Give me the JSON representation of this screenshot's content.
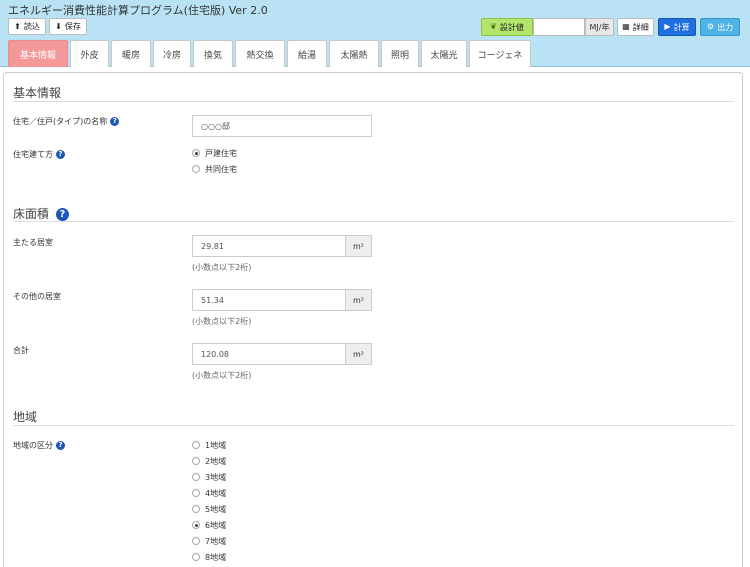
{
  "app": {
    "title": "エネルギー消費性能計算プログラム(住宅版) Ver 2.0"
  },
  "toolbar": {
    "load_label": "読込",
    "save_label": "保存",
    "design_label": "設計値",
    "design_value": "",
    "unit_label": "MJ/年",
    "detail_label": "詳細",
    "calc_label": "計算",
    "output_label": "出力"
  },
  "tabs": [
    {
      "label": "基本情報",
      "active": true
    },
    {
      "label": "外皮"
    },
    {
      "label": "暖房"
    },
    {
      "label": "冷房"
    },
    {
      "label": "換気"
    },
    {
      "label": "熱交換"
    },
    {
      "label": "給湯"
    },
    {
      "label": "太陽熱"
    },
    {
      "label": "照明"
    },
    {
      "label": "太陽光"
    },
    {
      "label": "コージェネ"
    }
  ],
  "basic": {
    "title": "基本情報",
    "name_label": "住宅／住戸(タイプ)の名称",
    "name_value": "○○○邸",
    "type_label": "住宅建て方",
    "type_options": [
      "戸建住宅",
      "共同住宅"
    ],
    "type_selected": "戸建住宅"
  },
  "floor": {
    "title": "床面積",
    "main_label": "主たる居室",
    "main_value": "29.81",
    "other_label": "その他の居室",
    "other_value": "51.34",
    "total_label": "合計",
    "total_value": "120.08",
    "unit": "m²",
    "note": "(小数点以下2桁)"
  },
  "region": {
    "title": "地域",
    "label": "地域の区分",
    "options": [
      "1地域",
      "2地域",
      "3地域",
      "4地域",
      "5地域",
      "6地域",
      "7地域",
      "8地域"
    ],
    "selected": "6地域"
  },
  "icons": {
    "help": "help-circle-icon",
    "upload": "upload-icon",
    "download": "download-icon",
    "leaf": "leaf-icon",
    "grid": "grid-icon",
    "play": "play-icon",
    "gear": "gear-icon"
  },
  "colors": {
    "header_bg": "#b9e3f5",
    "active_tab": "#f5989a",
    "design_btn": "#b5e46c",
    "calc_btn": "#1f6fe0",
    "output_btn": "#4fb3e6",
    "help_icon": "#1c57b8"
  }
}
